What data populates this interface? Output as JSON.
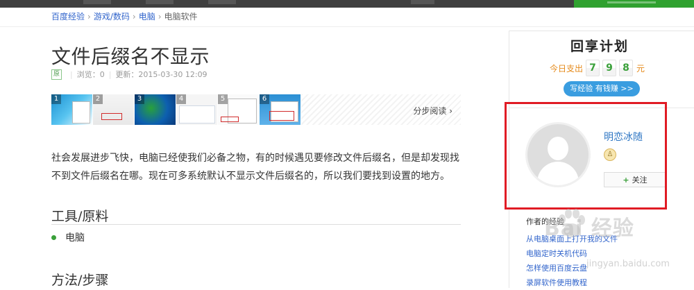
{
  "breadcrumb": [
    "百度经验",
    "游戏/数码",
    "电脑",
    "电脑软件"
  ],
  "article": {
    "title": "文件后缀名不显示",
    "original_badge": "原",
    "views": "浏览：0",
    "updated": "更新：2015-03-30 12:09",
    "step_numbers": [
      "1",
      "2",
      "3",
      "4",
      "5",
      "6"
    ],
    "step_read_link": "分步阅读",
    "intro": "社会发展进步飞快，电脑已经使我们必备之物，有的时候遇见要修改文件后缀名，但是却发现找不到文件后缀名在哪。现在可多系统默认不显示文件后缀名的，所以我们要找到设置的地方。",
    "tools_heading": "工具/原料",
    "tools": [
      "电脑"
    ],
    "method_heading": "方法/步骤"
  },
  "sidebar": {
    "brand": "回享计划",
    "today_label": "今日支出",
    "today_digits": [
      "7",
      "9",
      "8"
    ],
    "today_unit": "元",
    "write_button": "写经验 有钱赚 >>",
    "author": {
      "name": "明恋冰随",
      "follow_label": "关注"
    },
    "author_exp_title": "作者的经验",
    "experiences": [
      "从电脑桌面上打开我的文件",
      "电脑定时关机代码",
      "怎样使用百度云盘",
      "录屏软件使用教程"
    ],
    "watermark": "Bai 经验",
    "watermark_url": "jingyan.baidu.com"
  },
  "colors": {
    "link": "#3366cc",
    "accent_green": "#3aa03a",
    "highlight_red": "#e01b24",
    "button_blue": "#3a9de0"
  }
}
